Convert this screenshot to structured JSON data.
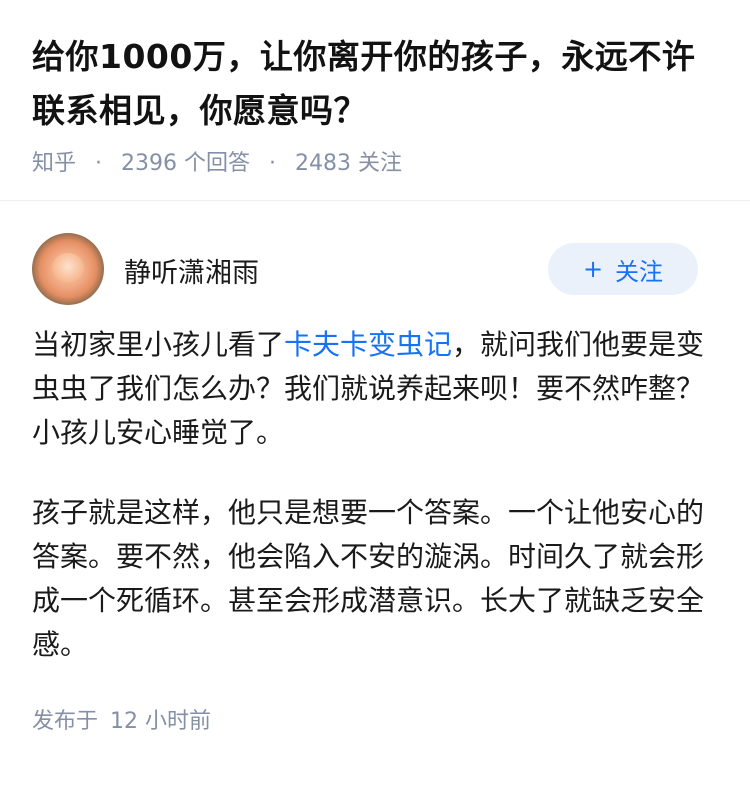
{
  "question": {
    "title": "给你1000万，让你离开你的孩子，永远不许联系相见，你愿意吗？",
    "source": "知乎",
    "answer_count": "2396",
    "answer_label": "个回答",
    "follower_count": "2483",
    "follower_label": "关注"
  },
  "author": {
    "name": "静听潇湘雨",
    "follow_label": "关注",
    "follow_icon": "plus-icon"
  },
  "answer": {
    "p1_before": "当初家里小孩儿看了",
    "p1_link": "卡夫卡变虫记",
    "p1_after": "，就问我们他要是变虫虫了我们怎么办？我们就说养起来呗！要不然咋整？小孩儿安心睡觉了。",
    "p2": "孩子就是这样，他只是想要一个答案。一个让他安心的答案。要不然，他会陷入不安的漩涡。时间久了就会形成一个死循环。甚至会形成潜意识。长大了就缺乏安全感。"
  },
  "footer": {
    "published_label": "发布于",
    "published_time": "12 小时前"
  },
  "colors": {
    "link": "#1772f6",
    "meta": "#8590a6",
    "follow_bg": "#eaf1fb"
  }
}
